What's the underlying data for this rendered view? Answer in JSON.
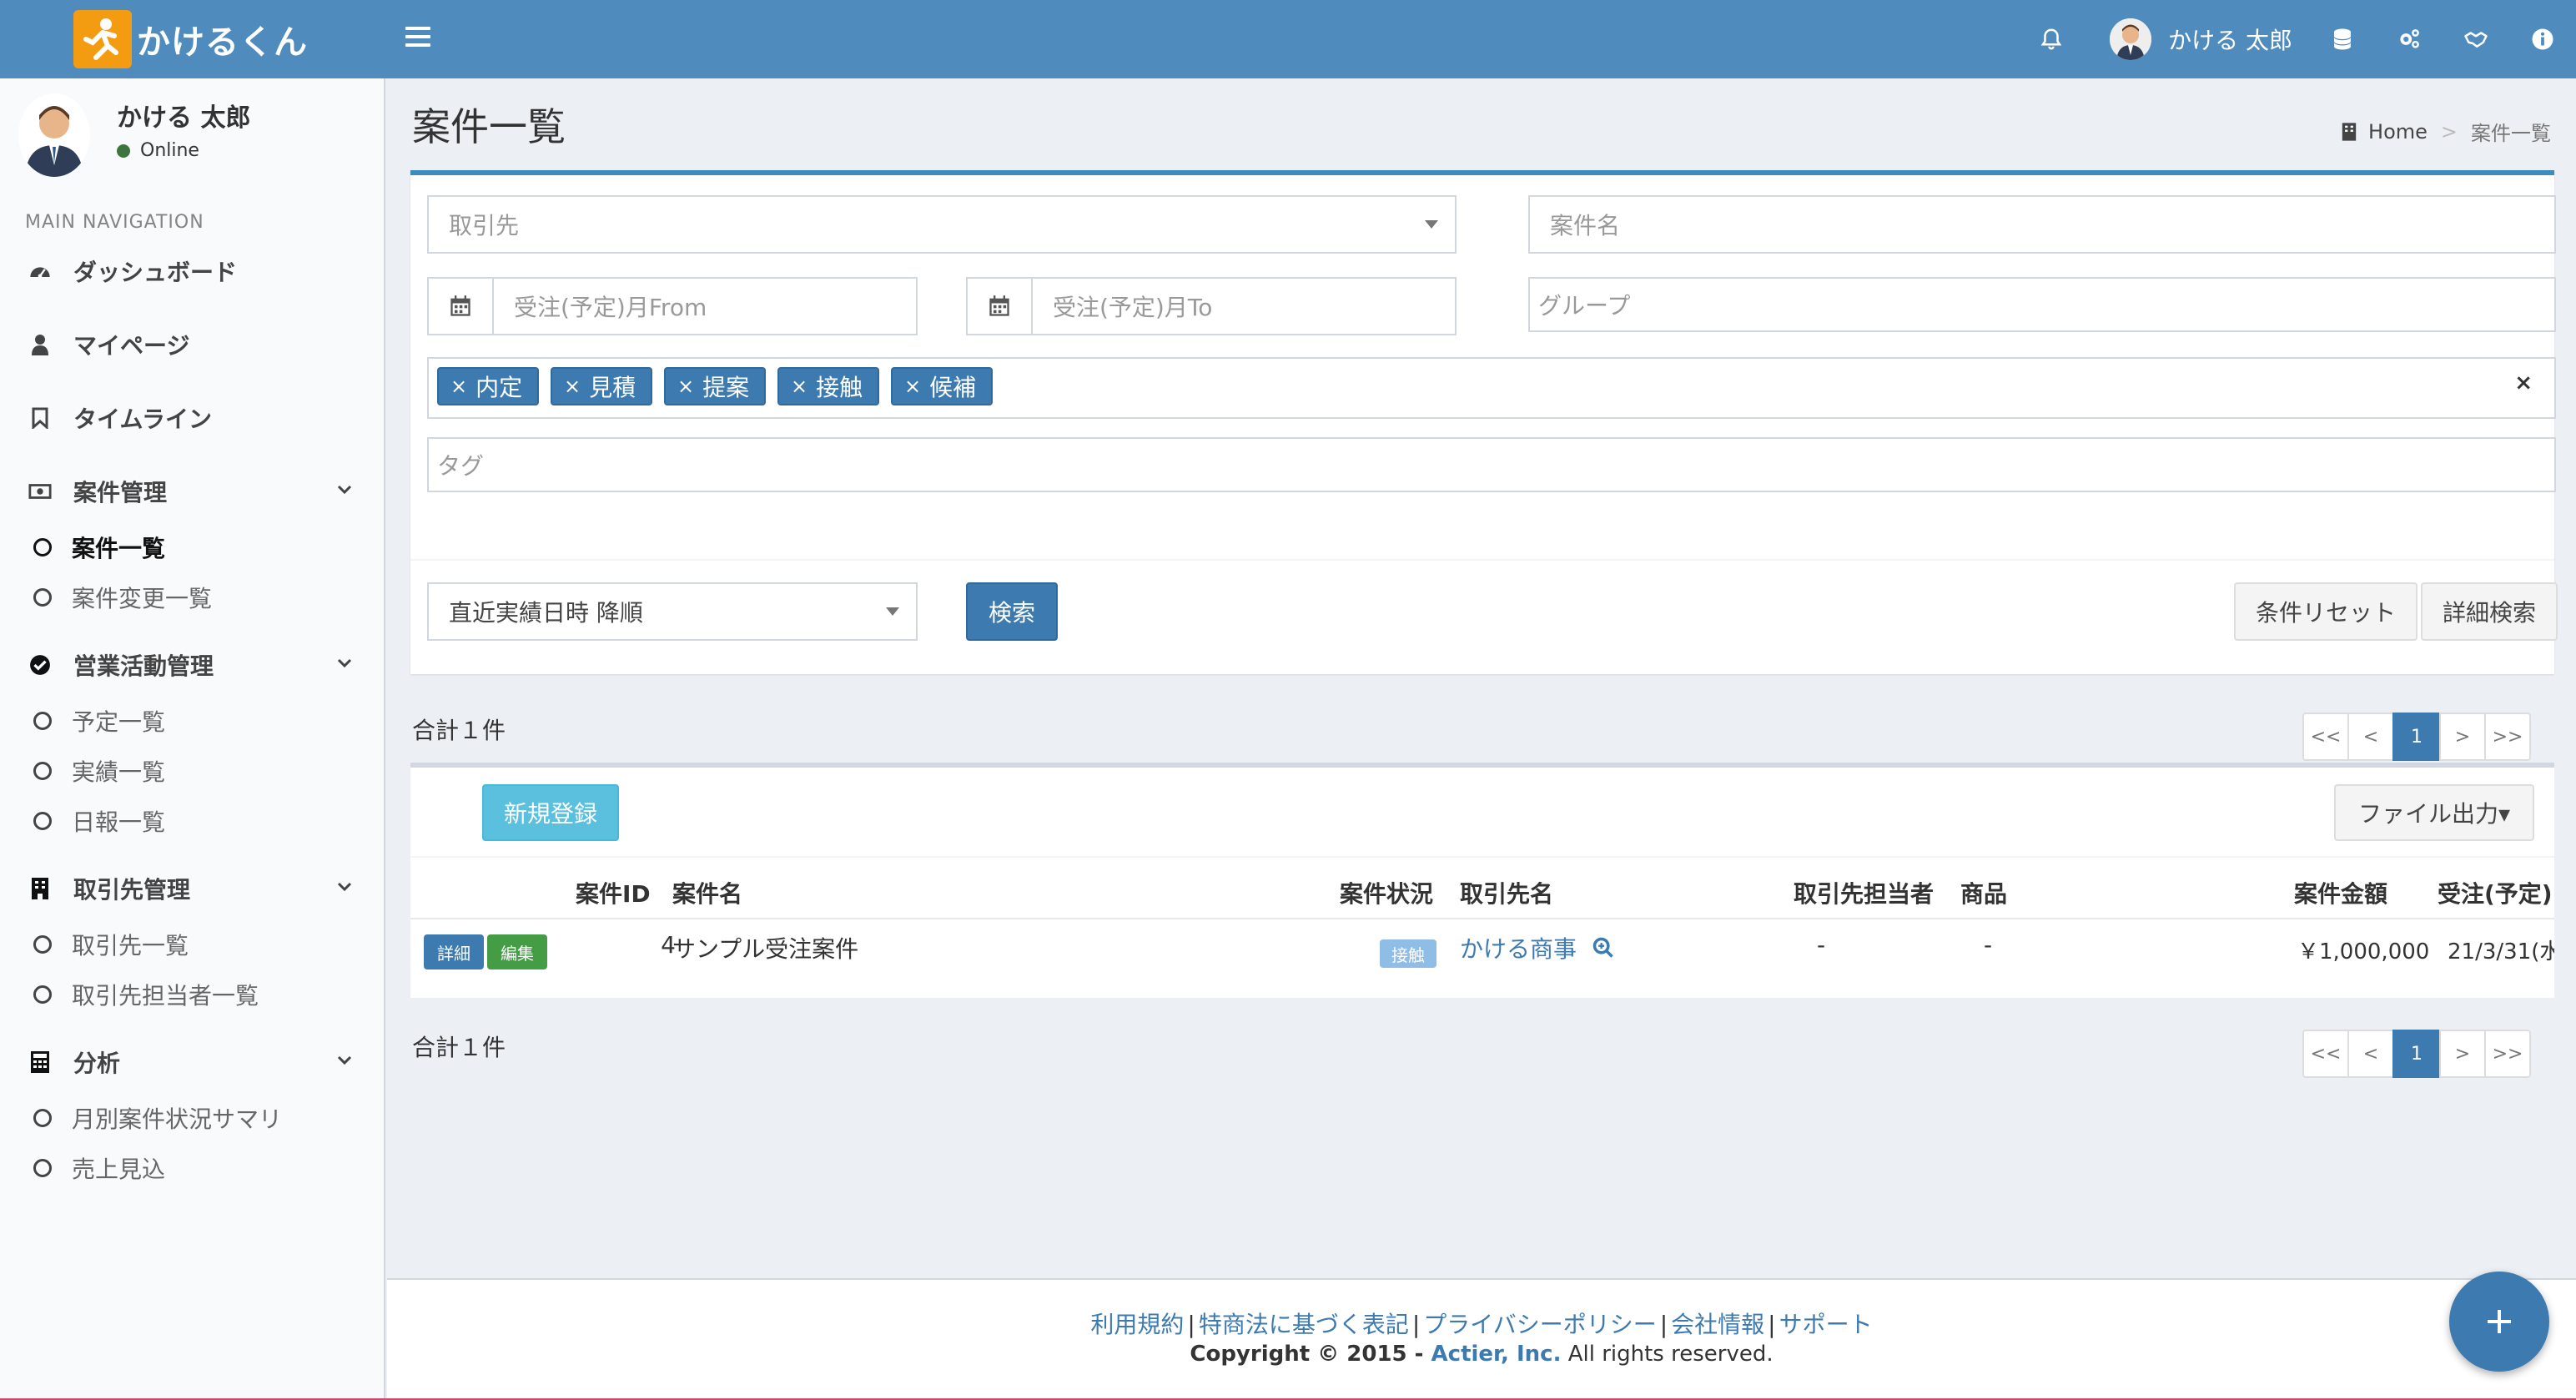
{
  "app": {
    "logo_text": "かけるくん",
    "brand_color": "#4f8cbd",
    "logo_color": "#f39c12"
  },
  "topbar": {
    "user_name": "かける 太郎",
    "icons": [
      "bell-icon",
      "database-icon",
      "cogs-icon",
      "handshake-icon",
      "info-icon"
    ]
  },
  "sidebar": {
    "user_name": "かける 太郎",
    "status": "Online",
    "nav_header": "MAIN NAVIGATION",
    "items": [
      {
        "label": "ダッシュボード",
        "icon": "dashboard-icon"
      },
      {
        "label": "マイページ",
        "icon": "user-icon"
      },
      {
        "label": "タイムライン",
        "icon": "bookmark-icon"
      },
      {
        "label": "案件管理",
        "icon": "money-icon"
      },
      {
        "label": "案件一覧",
        "active": true
      },
      {
        "label": "案件変更一覧"
      },
      {
        "label": "営業活動管理",
        "icon": "check-circle-icon"
      },
      {
        "label": "予定一覧"
      },
      {
        "label": "実績一覧"
      },
      {
        "label": "日報一覧"
      },
      {
        "label": "取引先管理",
        "icon": "building-icon"
      },
      {
        "label": "取引先一覧"
      },
      {
        "label": "取引先担当者一覧"
      },
      {
        "label": "分析",
        "icon": "calculator-icon"
      },
      {
        "label": "月別案件状況サマリ"
      },
      {
        "label": "売上見込"
      }
    ]
  },
  "page": {
    "title": "案件一覧",
    "breadcrumb": {
      "home": "Home",
      "sep": ">",
      "current": "案件一覧"
    }
  },
  "search": {
    "client_placeholder": "取引先",
    "project_name_placeholder": "案件名",
    "month_from_placeholder": "受注(予定)月From",
    "month_to_placeholder": "受注(予定)月To",
    "group_placeholder": "グループ",
    "status_chips": [
      "内定",
      "見積",
      "提案",
      "接触",
      "候補"
    ],
    "chip_remove": "×",
    "clear": "×",
    "tag_placeholder": "タグ",
    "sort_value": "直近実績日時 降順",
    "search_button": "検索",
    "reset_button": "条件リセット",
    "advanced_button": "詳細検索"
  },
  "results": {
    "total_text": "合計１件",
    "pager": [
      "<<",
      "<",
      "1",
      ">",
      ">>"
    ],
    "new_button": "新規登録",
    "export_button": "ファイル出力▾",
    "columns": [
      "案件ID",
      "案件名",
      "案件状況",
      "取引先名",
      "取引先担当者",
      "商品",
      "案件金額",
      "受注(予定)"
    ],
    "rows": [
      {
        "detail": "詳細",
        "edit": "編集",
        "id": "4",
        "name": "サンプル受注案件",
        "status": "接触",
        "client": "かける商事",
        "contact": "-",
        "product": "-",
        "amount": "￥1,000,000",
        "order_date": "21/3/31(水"
      }
    ]
  },
  "footer": {
    "links": [
      "利用規約",
      "特商法に基づく表記",
      "プライバシーポリシー",
      "会社情報",
      "サポート"
    ],
    "link_sep": "|",
    "copyright_prefix": "Copyright © 2015 - ",
    "company": "Actier, Inc.",
    "rights": " All rights reserved."
  }
}
